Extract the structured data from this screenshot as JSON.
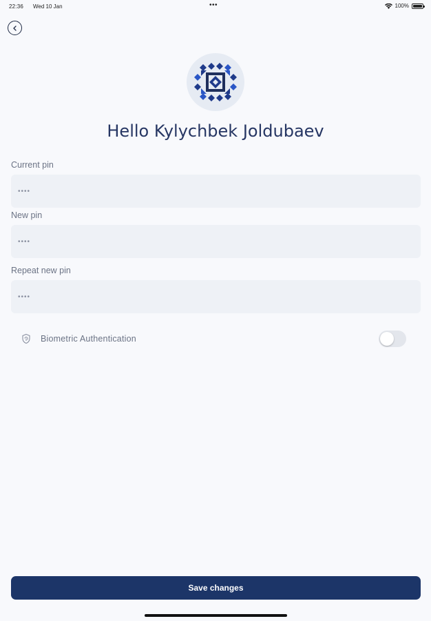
{
  "status_bar": {
    "time": "22:36",
    "date": "Wed 10 Jan",
    "dots": "•••",
    "battery_text": "100%",
    "battery_level": 1.0
  },
  "header": {
    "back_icon": "chevron-left-icon"
  },
  "profile": {
    "greeting": "Hello Kylychbek Joldubaev",
    "avatar_colors": {
      "background": "#e6ebf3",
      "primary": "#1f3a8a",
      "accent": "#2a56c6"
    }
  },
  "form": {
    "current_pin": {
      "label": "Current pin",
      "placeholder": "••••"
    },
    "new_pin": {
      "label": "New pin",
      "placeholder": "••••"
    },
    "repeat_pin": {
      "label": "Repeat new pin",
      "placeholder": "••••"
    }
  },
  "biometric": {
    "label": "Biometric Authentication",
    "icon": "fingerprint-shield-icon",
    "enabled": false
  },
  "actions": {
    "save_label": "Save changes"
  },
  "colors": {
    "primary": "#1c3568",
    "background": "#f8f9fc",
    "input_background": "#eef1f6"
  }
}
